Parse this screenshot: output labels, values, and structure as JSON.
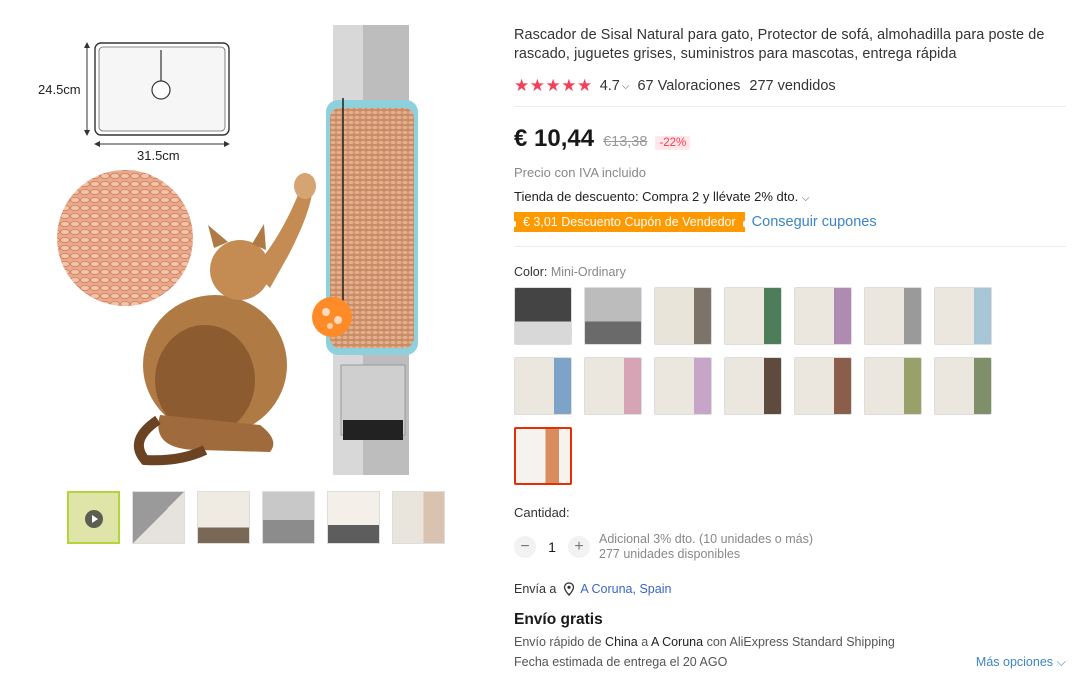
{
  "product": {
    "title": "Rascador de Sisal Natural para gato, Protector de sofá, almohadilla para poste de rascado, juguetes grises, suministros para mascotas, entrega rápida",
    "rating": "4.7",
    "reviews": "67 Valoraciones",
    "sold": "277 vendidos",
    "price": "€ 10,44",
    "old_price": "€13,38",
    "discount": "-22%",
    "vat_note": "Precio con IVA incluido",
    "store_discount": "Tienda de descuento: Compra 2 y llévate 2% dto.",
    "coupon": "€ 3,01 Descuento Cupón de Vendedor",
    "get_coupons": "Conseguir cupones"
  },
  "gallery": {
    "dimension_height": "24.5cm",
    "dimension_width": "31.5cm",
    "thumb_count": 6
  },
  "color": {
    "label": "Color:",
    "selected": "Mini-Ordinary",
    "swatch_count": 15
  },
  "quantity": {
    "label": "Cantidad:",
    "minus": "−",
    "value": "1",
    "plus": "+",
    "bulk_discount": "Adicional 3% dto. (10 unidades o más)",
    "available": "277 unidades disponibles"
  },
  "shipping": {
    "ship_to_label": "Envía a",
    "location": "A Coruna, Spain",
    "free_shipping": "Envío gratis",
    "line_prefix": "Envío rápido de",
    "origin": "China",
    "line_mid": "a",
    "destination": "A Coruna",
    "line_with": "con AliExpress Standard Shipping",
    "delivery": "Fecha estimada de entrega el 20 AGO",
    "more_options": "Más opciones"
  },
  "colors": {
    "star": "#f44057",
    "coupon_bg": "#ff9900",
    "link": "#3b85c4",
    "selected_border": "#e62e04"
  }
}
